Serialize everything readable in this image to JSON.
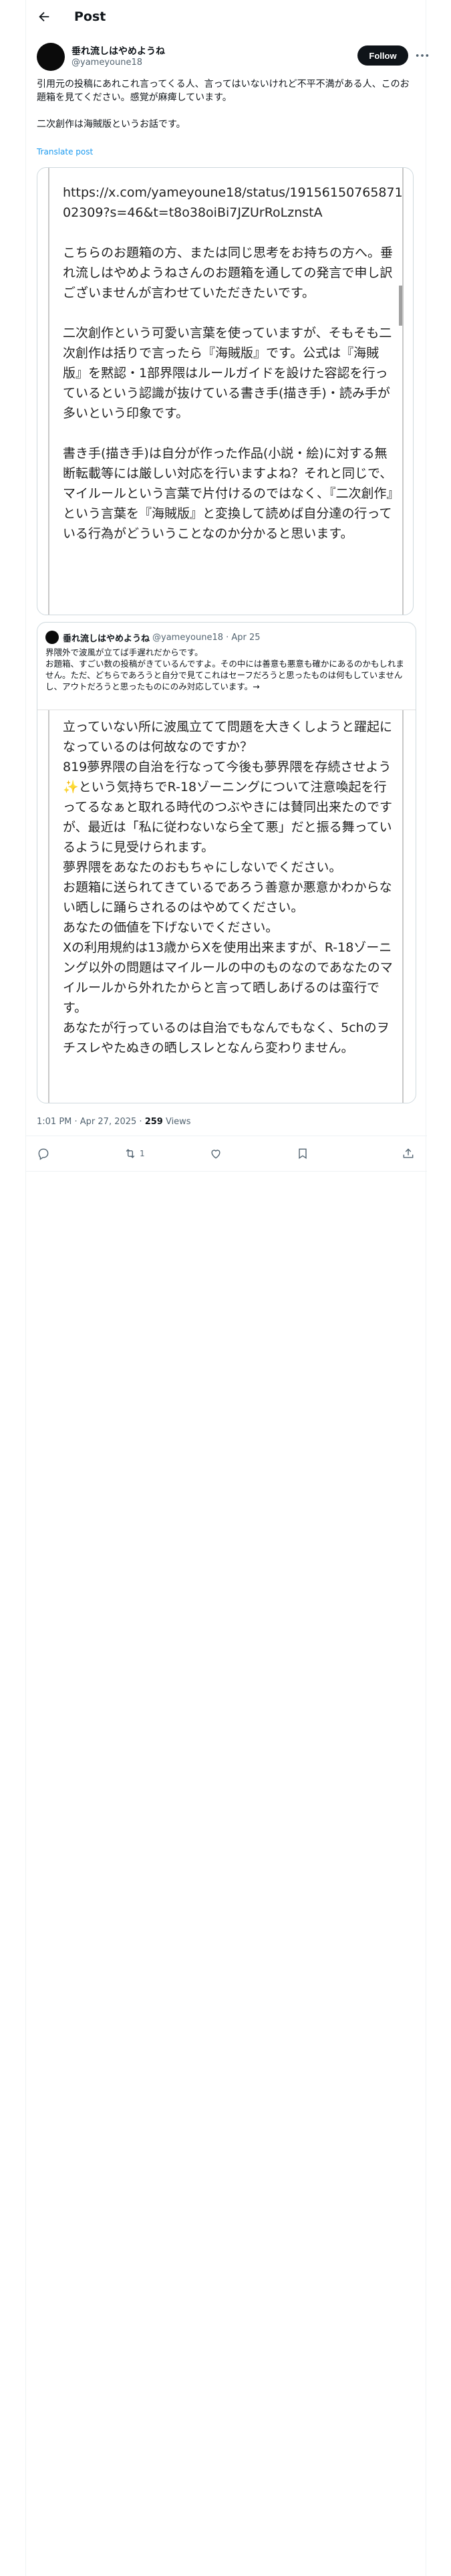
{
  "header": {
    "title": "Post"
  },
  "post": {
    "author_name": "垂れ流しはやめようね",
    "author_handle": "@yameyoune18",
    "follow_label": "Follow",
    "text": "引用元の投稿にあれこれ言ってくる人、言ってはいないけれど不平不満がある人、このお題箱を見てください。感覚が麻痺しています。\n\n二次創作は海賊版というお話です。",
    "translate_label": "Translate post",
    "image_text": "https://x.com/yameyoune18/status/19156150765871 02309?s=46&t=t8o38oiBi7JZUrRoLznstA\n\nこちらのお題箱の方、または同じ思考をお持ちの方へ。垂れ流しはやめようねさんのお題箱を通しての発言で申し訳ございませんが言わせていただきたいです。\n\n二次創作という可愛い言葉を使っていますが、そもそも二次創作は括りで言ったら『海賊版』です。公式は『海賊版』を黙認・1部界隈はルールガイドを設けた容認を行っているという認識が抜けている書き手(描き手)・読み手が多いという印象です。\n\n書き手(描き手)は自分が作った作品(小説・絵)に対する無断転載等には厳しい対応を行いますよね？それと同じで、マイルールという言葉で片付けるのではなく、『二次創作』という言葉を『海賊版』と変換して読めば自分達の行っている行為がどういうことなのか分かると思います。",
    "timestamp": "1:01 PM · Apr 27, 2025 · ",
    "views_count": "259",
    "views_label": " Views",
    "repost_count": "1"
  },
  "quote": {
    "author_name": "垂れ流しはやめようね",
    "author_handle": "@yameyoune18 · Apr 25",
    "text": "界隈外で波風が立てば手遅れだからです。\nお題箱、すごい数の投稿がきているんですよ。その中には善意も悪意も確かにあるのかもしれません。ただ、どちらであろうと自分で見てこれはセーフだろうと思ったものは何もしていませんし、アウトだろうと思ったものにのみ対応しています。→",
    "image_text": "立っていない所に波風立てて問題を大きくしようと躍起になっているのは何故なのですか？\n819夢界隈の自治を行なって今後も夢界隈を存続させよう✨という気持ちでR-18ゾーニングについて注意喚起を行ってるなぁと取れる時代のつぶやきには賛同出来たのですが、最近は「私に従わないなら全て悪」だと振る舞っているように見受けられます。\n夢界隈をあなたのおもちゃにしないでください。\nお題箱に送られてきているであろう善意か悪意かわからない晒しに踊らされるのはやめてください。\nあなたの価値を下げないでください。\nXの利用規約は13歳からXを使用出来ますが、R-18ゾーニング以外の問題はマイルールの中のものなのであなたのマイルールから外れたからと言って晒しあげるのは蛮行です。\nあなたが行っているのは自治でもなんでもなく、5chのヲチスレやたぬきの晒しスレとなんら変わりません。"
  },
  "colors": {
    "accent": "#1d9bf0",
    "text": "#0f1419",
    "muted": "#536471"
  }
}
